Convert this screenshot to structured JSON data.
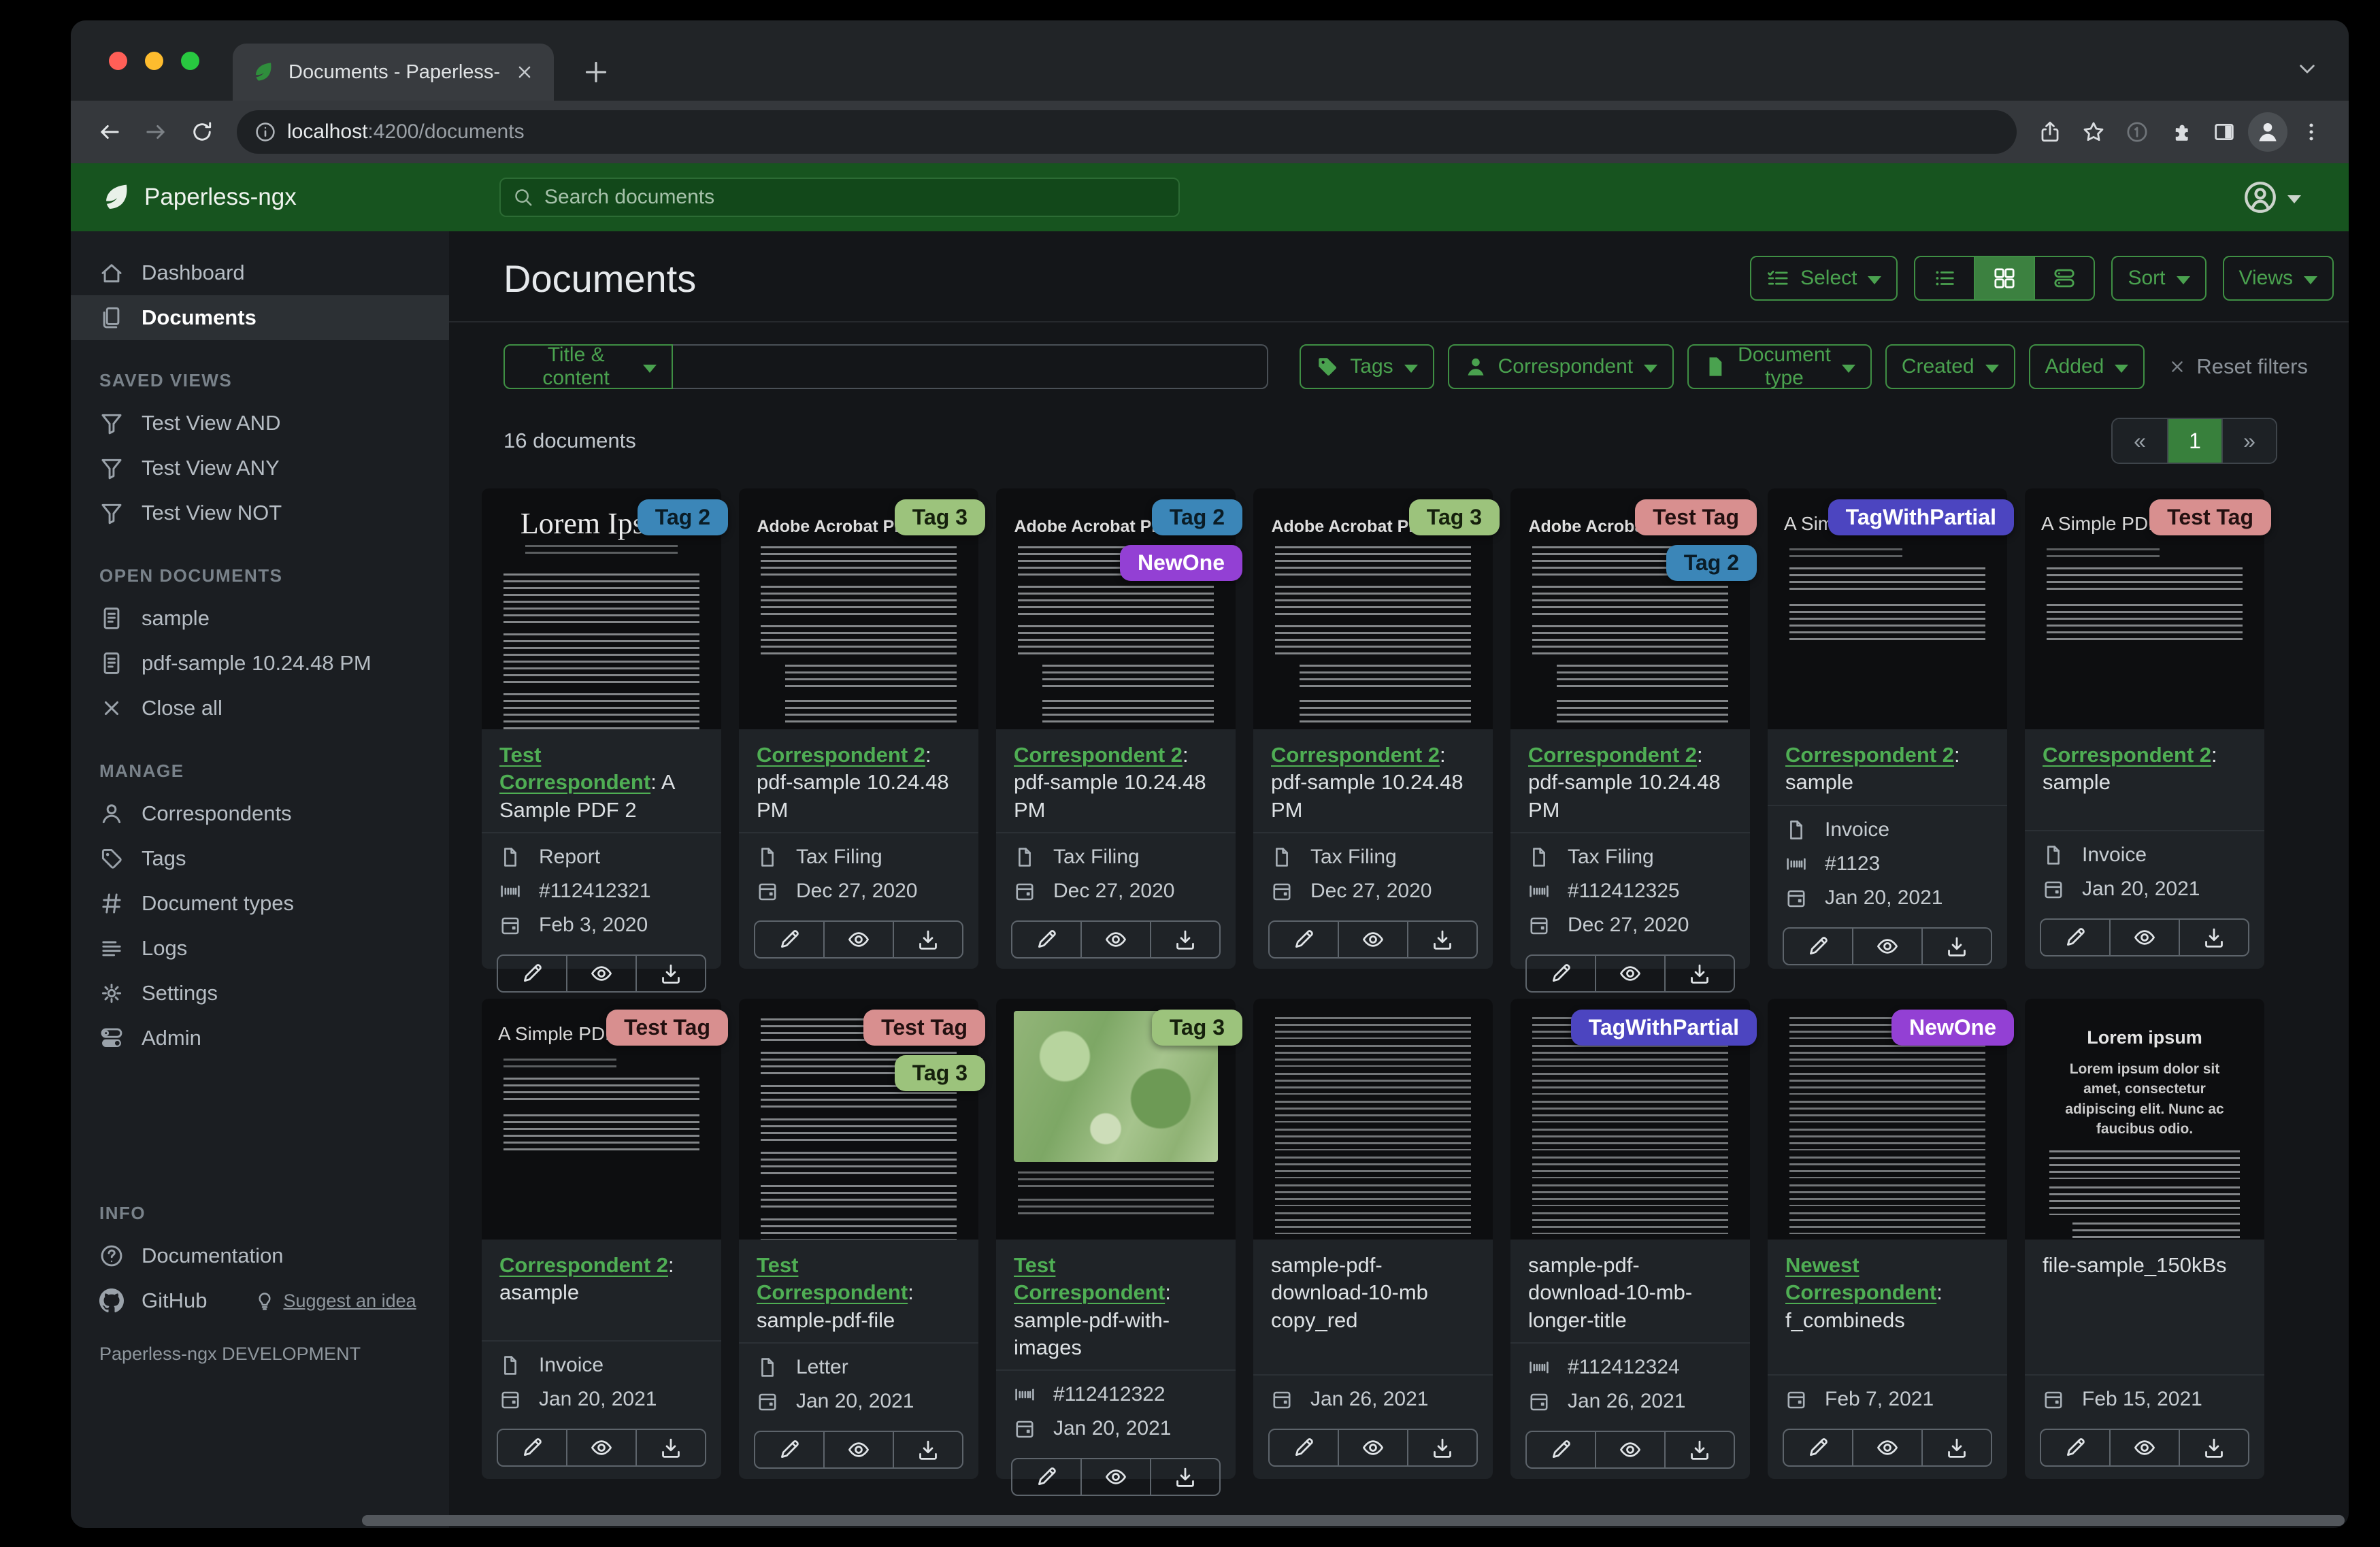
{
  "browser": {
    "tab_title": "Documents - Paperless-ngx",
    "url_host": "localhost",
    "url_path": ":4200/documents"
  },
  "header": {
    "app_name": "Paperless-ngx",
    "search_placeholder": "Search documents"
  },
  "colors": {
    "brand_green": "#17541f",
    "accent_green": "#45a04b",
    "active_green": "#38803c",
    "link_green": "#4fae54"
  },
  "sidebar": {
    "sections": [
      {
        "items": [
          {
            "icon": "home",
            "label": "Dashboard"
          },
          {
            "icon": "files",
            "label": "Documents",
            "active": true
          }
        ]
      },
      {
        "label": "SAVED VIEWS",
        "items": [
          {
            "icon": "funnel",
            "label": "Test View AND"
          },
          {
            "icon": "funnel",
            "label": "Test View ANY"
          },
          {
            "icon": "funnel",
            "label": "Test View NOT"
          }
        ]
      },
      {
        "label": "OPEN DOCUMENTS",
        "items": [
          {
            "icon": "fileText",
            "label": "sample"
          },
          {
            "icon": "fileText",
            "label": "pdf-sample 10.24.48 PM"
          },
          {
            "icon": "xIcon",
            "label": "Close all"
          }
        ]
      },
      {
        "label": "MANAGE",
        "items": [
          {
            "icon": "person",
            "label": "Correspondents"
          },
          {
            "icon": "tagO",
            "label": "Tags"
          },
          {
            "icon": "hash",
            "label": "Document types"
          },
          {
            "icon": "listIcon",
            "label": "Logs"
          },
          {
            "icon": "gear",
            "label": "Settings"
          },
          {
            "icon": "toggles",
            "label": "Admin"
          }
        ]
      },
      {
        "label": "INFO",
        "push_bottom": true,
        "items": [
          {
            "icon": "question",
            "label": "Documentation"
          },
          {
            "icon": "github",
            "label": "GitHub",
            "extra": {
              "icon": "lightbulb",
              "label": "Suggest an idea"
            }
          }
        ]
      }
    ],
    "footer": "Paperless-ngx DEVELOPMENT"
  },
  "page": {
    "title": "Documents",
    "select_label": "Select",
    "sort_label": "Sort",
    "views_label": "Views",
    "count_text": "16 documents",
    "reset_filters": "Reset filters",
    "pagination": {
      "prev": "«",
      "current": "1",
      "next": "»"
    }
  },
  "filters": {
    "field_selector": "Title & content",
    "buttons": [
      {
        "icon": "tagFill",
        "label": "Tags"
      },
      {
        "icon": "personFill",
        "label": "Correspondent"
      },
      {
        "icon": "fileFill",
        "label": "Document type"
      },
      {
        "label": "Created"
      },
      {
        "label": "Added"
      }
    ]
  },
  "tag_palette": {
    "Tag 2": {
      "bg": "#3b86b8",
      "fg": "#0a1c26"
    },
    "Tag 3": {
      "bg": "#9cc37c",
      "fg": "#15200c"
    },
    "NewOne": {
      "bg": "#9340d4",
      "fg": "#ffffff"
    },
    "Test Tag": {
      "bg": "#d88f8f",
      "fg": "#231010"
    },
    "TagWithPartial": {
      "bg": "#4c45c0",
      "fg": "#ffffff"
    }
  },
  "documents": [
    {
      "thumb": {
        "kind": "lorem-classic",
        "title": "Lorem Ipsum"
      },
      "tags": [
        "Tag 2"
      ],
      "correspondent": "Test Correspondent",
      "title_rest": ": A Sample PDF 2",
      "doc_type": "Report",
      "asn": "#112412321",
      "date": "Feb 3, 2020"
    },
    {
      "thumb": {
        "kind": "acrobat",
        "title": "Adobe Acrobat PDF Files"
      },
      "tags": [
        "Tag 3"
      ],
      "correspondent": "Correspondent 2",
      "title_rest": ": pdf-sample 10.24.48 PM",
      "doc_type": "Tax Filing",
      "asn": null,
      "date": "Dec 27, 2020"
    },
    {
      "thumb": {
        "kind": "acrobat",
        "title": "Adobe Acrobat PDF Files"
      },
      "tags": [
        "Tag 2",
        "NewOne"
      ],
      "correspondent": "Correspondent 2",
      "title_rest": ": pdf-sample 10.24.48 PM",
      "doc_type": "Tax Filing",
      "asn": null,
      "date": "Dec 27, 2020"
    },
    {
      "thumb": {
        "kind": "acrobat",
        "title": "Adobe Acrobat PDF Files"
      },
      "tags": [
        "Tag 3"
      ],
      "correspondent": "Correspondent 2",
      "title_rest": ": pdf-sample 10.24.48 PM",
      "doc_type": "Tax Filing",
      "asn": null,
      "date": "Dec 27, 2020"
    },
    {
      "thumb": {
        "kind": "acrobat",
        "title": "Adobe Acrobat PDF Files"
      },
      "tags": [
        "Test Tag",
        "Tag 2"
      ],
      "correspondent": "Correspondent 2",
      "title_rest": ": pdf-sample 10.24.48 PM",
      "doc_type": "Tax Filing",
      "asn": "#112412325",
      "date": "Dec 27, 2020"
    },
    {
      "thumb": {
        "kind": "simple",
        "title": "A Simple PDF File"
      },
      "tags": [
        "TagWithPartial"
      ],
      "correspondent": "Correspondent 2",
      "title_rest": ": sample",
      "doc_type": "Invoice",
      "asn": "#1123",
      "date": "Jan 20, 2021"
    },
    {
      "thumb": {
        "kind": "simple",
        "title": "A Simple PDF File"
      },
      "tags": [
        "Test Tag"
      ],
      "correspondent": "Correspondent 2",
      "title_rest": ": sample",
      "doc_type": "Invoice",
      "asn": null,
      "date": "Jan 20, 2021"
    },
    {
      "thumb": {
        "kind": "simple",
        "title": "A Simple PDF File"
      },
      "tags": [
        "Test Tag"
      ],
      "correspondent": "Correspondent 2",
      "title_rest": ": asample",
      "doc_type": "Invoice",
      "asn": null,
      "date": "Jan 20, 2021"
    },
    {
      "thumb": {
        "kind": "lorem-dense",
        "title": null
      },
      "tags": [
        "Test Tag",
        "Tag 3"
      ],
      "correspondent": "Test Correspondent",
      "title_rest": ": sample-pdf-file",
      "doc_type": "Letter",
      "asn": null,
      "date": "Jan 20, 2021"
    },
    {
      "thumb": {
        "kind": "map",
        "title": null
      },
      "tags": [
        "Tag 3"
      ],
      "correspondent": "Test Correspondent",
      "title_rest": ": sample-pdf-with-images",
      "doc_type": null,
      "asn": "#112412322",
      "date": "Jan 20, 2021"
    },
    {
      "thumb": {
        "kind": "dense-plain",
        "title": null
      },
      "tags": [],
      "correspondent": null,
      "title_rest": "sample-pdf-download-10-mb copy_red",
      "doc_type": null,
      "asn": null,
      "date": "Jan 26, 2021"
    },
    {
      "thumb": {
        "kind": "dense-plain",
        "title": null
      },
      "tags": [
        "TagWithPartial"
      ],
      "correspondent": null,
      "title_rest": "sample-pdf-download-10-mb-longer-title",
      "doc_type": null,
      "asn": "#112412324",
      "date": "Jan 26, 2021"
    },
    {
      "thumb": {
        "kind": "dense-plain",
        "title": null
      },
      "tags": [
        "NewOne"
      ],
      "correspondent": "Newest Correspondent",
      "title_rest": ": f_combineds",
      "doc_type": null,
      "asn": null,
      "date": "Feb 7, 2021"
    },
    {
      "thumb": {
        "kind": "lorem-article",
        "title": "Lorem ipsum",
        "subtitle": "Lorem ipsum dolor sit amet, consectetur adipiscing elit. Nunc ac faucibus odio."
      },
      "tags": [],
      "correspondent": null,
      "title_rest": "file-sample_150kBs",
      "doc_type": null,
      "asn": null,
      "date": "Feb 15, 2021"
    }
  ]
}
